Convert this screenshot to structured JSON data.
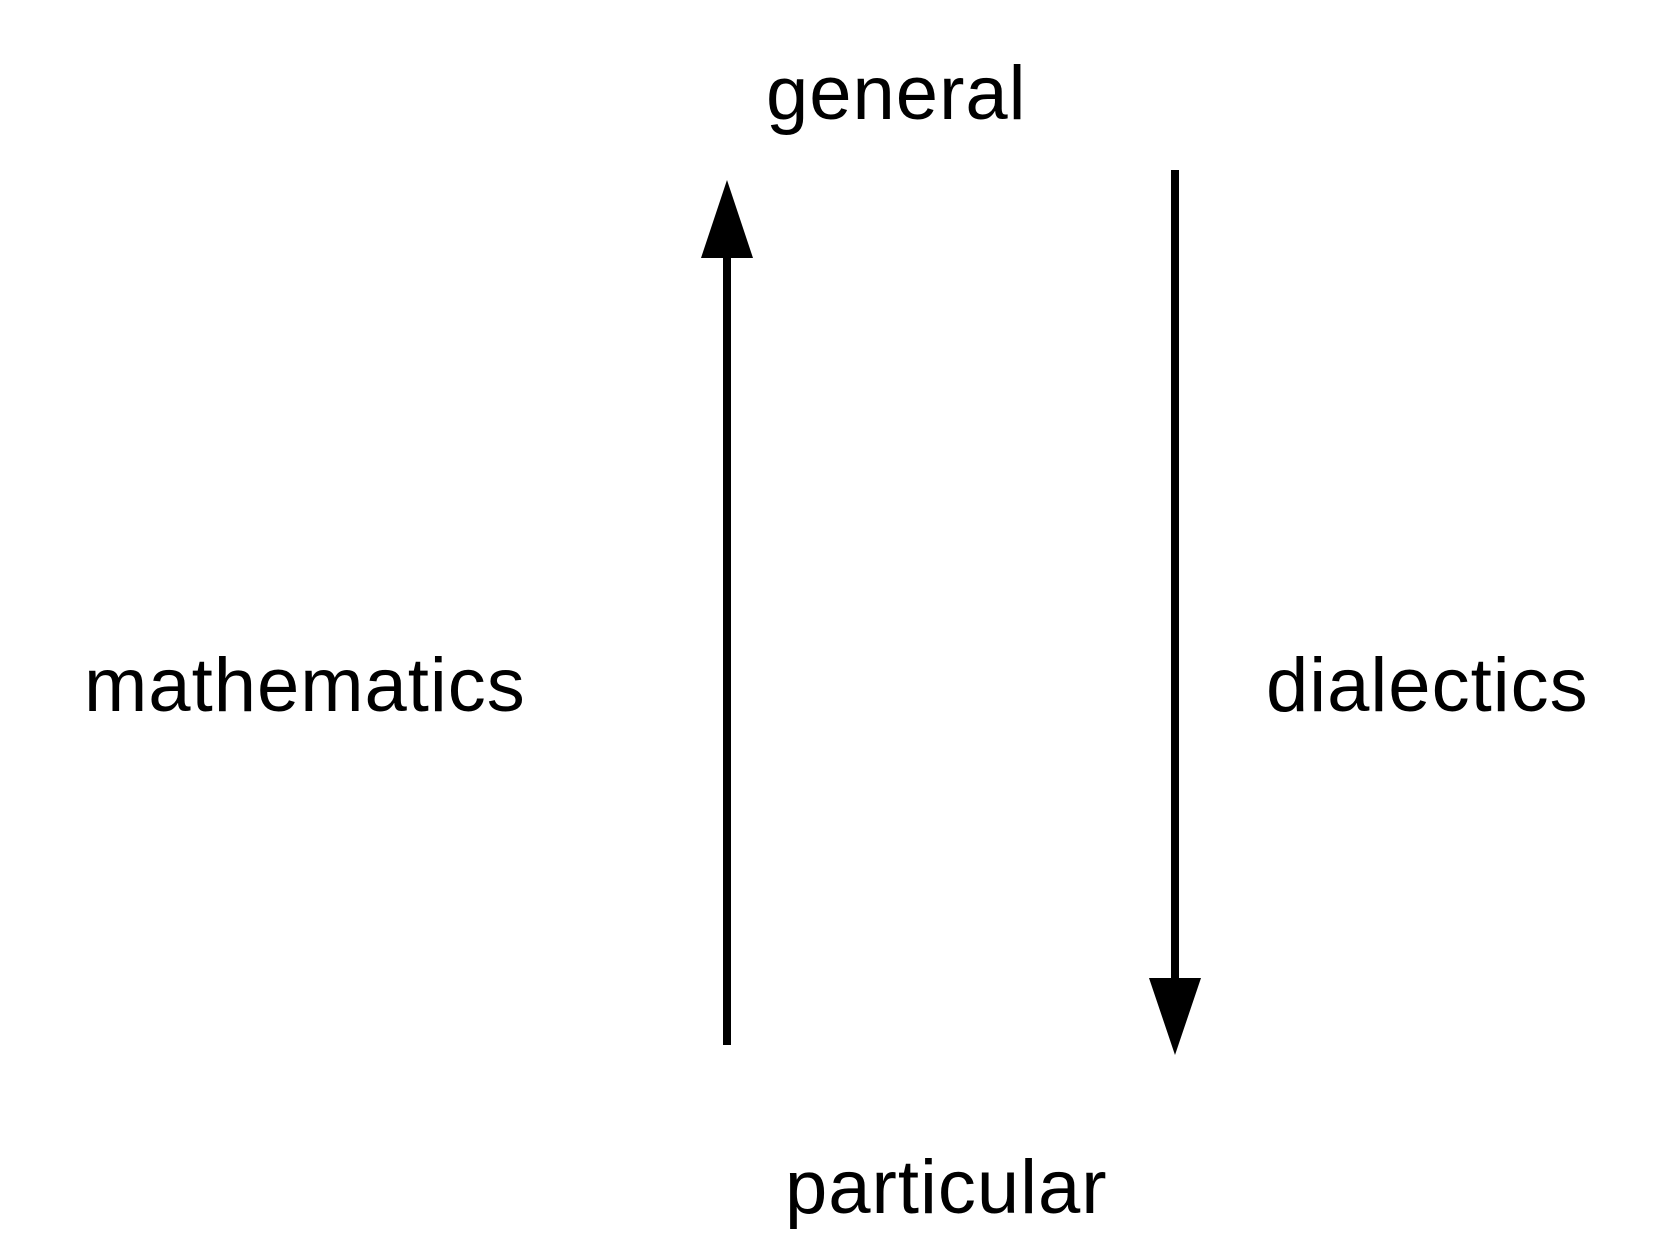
{
  "diagram": {
    "nodes": {
      "top": "general",
      "bottom": "particular",
      "left": "mathematics",
      "right": "dialectics"
    },
    "edges": [
      {
        "from": "particular",
        "to": "general",
        "label": "mathematics",
        "direction": "up"
      },
      {
        "from": "general",
        "to": "particular",
        "label": "dialectics",
        "direction": "down"
      }
    ],
    "colors": {
      "ink": "#000000",
      "background": "#ffffff"
    }
  }
}
